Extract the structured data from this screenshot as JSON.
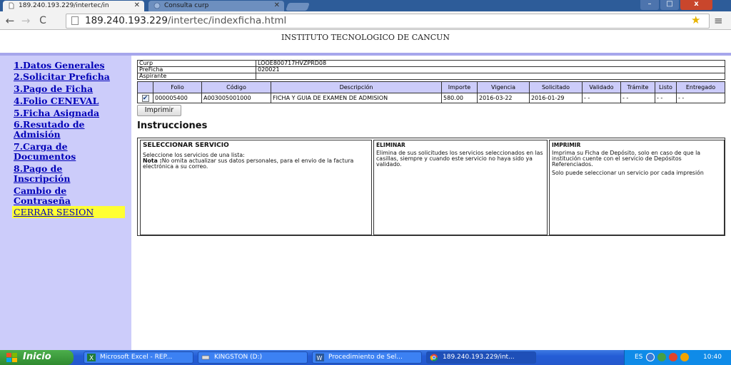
{
  "browser": {
    "tabs": [
      {
        "title": "189.240.193.229/intertec/in"
      },
      {
        "title": "Consulta curp"
      }
    ],
    "url_host": "189.240.193.229",
    "url_path": "/intertec/indexficha.html"
  },
  "page": {
    "header": "INSTITUTO TECNOLOGICO DE CANCUN"
  },
  "sidebar": {
    "items": [
      {
        "label": "1.Datos Generales"
      },
      {
        "label": "2.Solicitar Preficha"
      },
      {
        "label": "3.Pago de Ficha"
      },
      {
        "label": "4.Folio CENEVAL"
      },
      {
        "label": "5.Ficha Asignada"
      },
      {
        "label": "6.Resutado de"
      },
      {
        "label": "Admisión"
      },
      {
        "label": "7.Carga de"
      },
      {
        "label": "Documentos"
      },
      {
        "label": "8.Pago de"
      },
      {
        "label": "Inscripción"
      },
      {
        "label": "Cambio de"
      },
      {
        "label": "Contraseña"
      }
    ],
    "logout": "CERRAR SESION"
  },
  "info": {
    "curp_label": "Curp",
    "curp_value": "LOOE800717HVZPRD08",
    "preficha_label": "PreFicha",
    "preficha_value": "020021",
    "aspirante_label": "Aspirante",
    "aspirante_value": ""
  },
  "table": {
    "headers": [
      "Folio",
      "Código",
      "Descripción",
      "Importe",
      "Vigencia",
      "Solicitado",
      "Validado",
      "Trámite",
      "Listo",
      "Entregado"
    ],
    "rows": [
      {
        "folio": "000005400",
        "codigo": "A003005001000",
        "descripcion": "FICHA Y GUIA DE EXAMEN DE ADMISION",
        "importe": "580.00",
        "vigencia": "2016-03-22",
        "solicitado": "2016-01-29",
        "validado": "- -",
        "tramite": "- -",
        "listo": "- -",
        "entregado": "- -"
      }
    ]
  },
  "print_button": "Imprimir",
  "instructions": {
    "title": "Instrucciones",
    "select": {
      "heading": "SELECCIONAR SERVICIO",
      "text": "Seleccione los servicios de una lista:",
      "note_label": "Nota :",
      "note_text": "No omita actualizar sus datos personales, para el envio de la factura electrónica a su correo."
    },
    "delete": {
      "heading": "ELIMINAR",
      "text": "Elimina de sus solicitudes los servicios seleccionados en las casillas, siempre y cuando este servicio no haya sido ya validado."
    },
    "print": {
      "heading": "IMPRIMIR",
      "text1": "Imprima su Ficha de Depósito, solo en caso de que la institución cuente con el servicio de Depósitos Referenciados.",
      "text2": "Solo puede seleccionar un servicio por cada impresión"
    }
  },
  "taskbar": {
    "start": "Inicio",
    "tasks": [
      {
        "label": "Microsoft Excel - REP..."
      },
      {
        "label": "KINGSTON (D:)"
      },
      {
        "label": "Procedimiento de Sel..."
      },
      {
        "label": "189.240.193.229/int..."
      }
    ],
    "lang": "ES",
    "clock": "10:40"
  },
  "colors": {
    "sidebar_bg": "#ccccfa",
    "link": "#0000b8",
    "logout_bg": "#ffff33",
    "table_header_bg": "#ccccfa"
  }
}
